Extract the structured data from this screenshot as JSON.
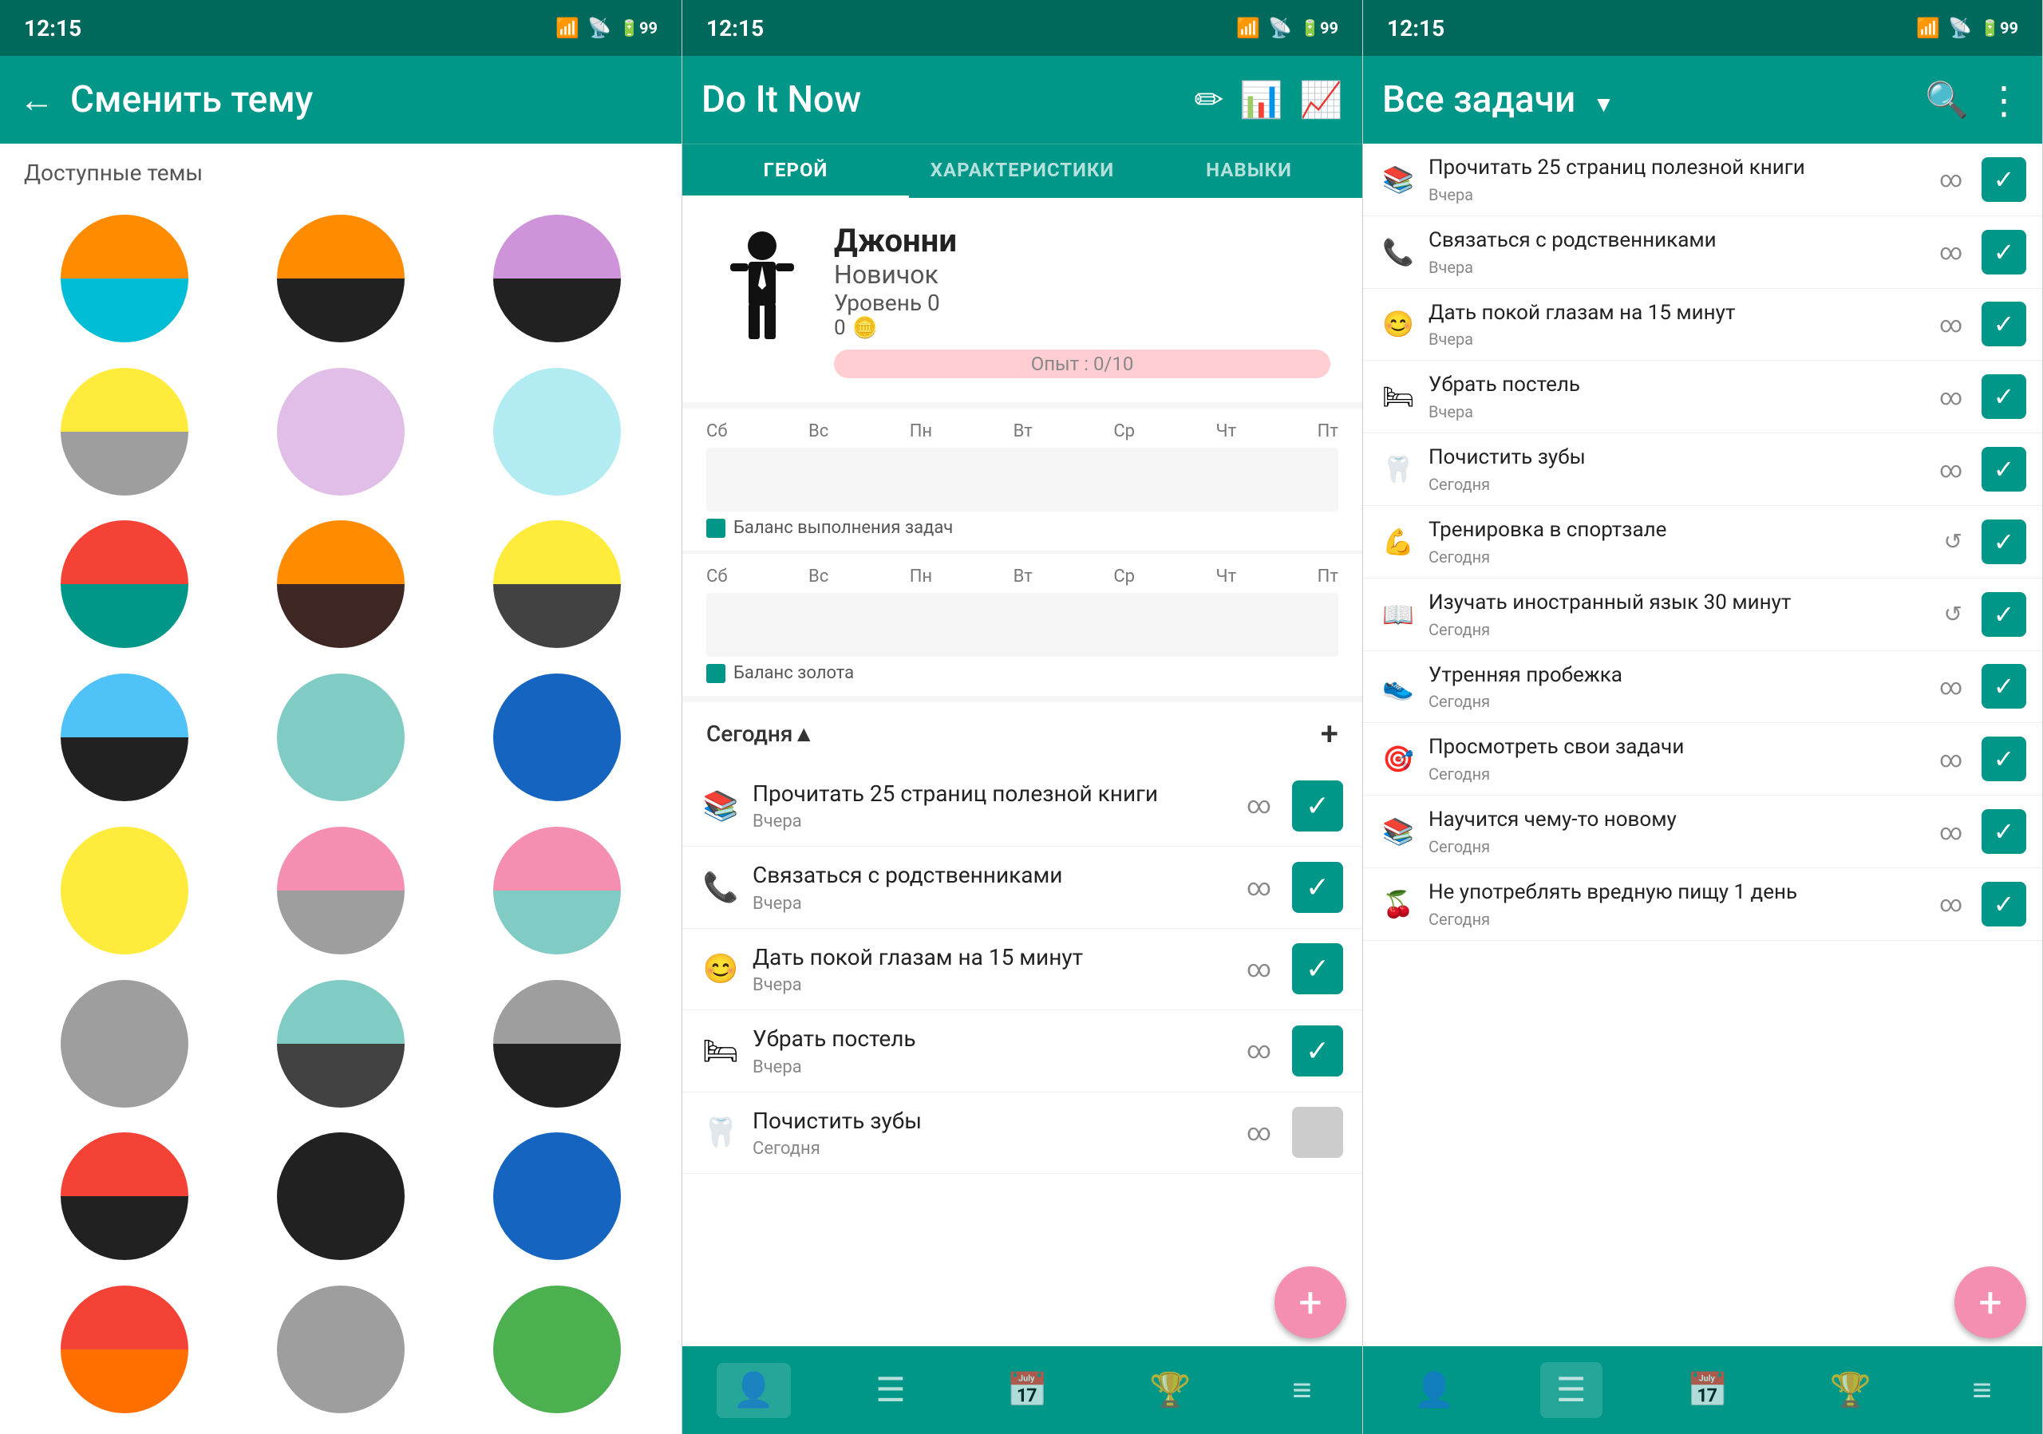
{
  "panel1": {
    "status_time": "12:15",
    "header": {
      "back_label": "←",
      "title": "Сменить тему"
    },
    "section_label": "Доступные темы",
    "themes": [
      {
        "top": "#FF8C00",
        "bottom": "#00BCD4"
      },
      {
        "top": "#FF8C00",
        "bottom": "#212121"
      },
      {
        "top": "#CE93D8",
        "bottom": "#212121"
      },
      {
        "top": "#FFEB3B",
        "bottom": "#9E9E9E"
      },
      {
        "top": "#E1BEE7",
        "bottom": "#E1BEE7"
      },
      {
        "top": "#B2EBF2",
        "bottom": "#B2EBF2"
      },
      {
        "top": "#F44336",
        "bottom": "#009688"
      },
      {
        "top": "#FF8C00",
        "bottom": "#3E2723"
      },
      {
        "top": "#FFEB3B",
        "bottom": "#424242"
      },
      {
        "top": "#4FC3F7",
        "bottom": "#212121"
      },
      {
        "top": "#80CBC4",
        "bottom": "#80CBC4"
      },
      {
        "top": "#1565C0",
        "bottom": "#1565C0"
      },
      {
        "top": "#FFEB3B",
        "bottom": "#FFEB3B"
      },
      {
        "top": "#F48FB1",
        "bottom": "#9E9E9E"
      },
      {
        "top": "#F48FB1",
        "bottom": "#80CBC4"
      },
      {
        "top": "#9E9E9E",
        "bottom": "#9E9E9E"
      },
      {
        "top": "#80CBC4",
        "bottom": "#424242"
      },
      {
        "top": "#9E9E9E",
        "bottom": "#212121"
      },
      {
        "top": "#F44336",
        "bottom": "#212121"
      },
      {
        "top": "#212121",
        "bottom": "#212121"
      },
      {
        "top": "#1565C0",
        "bottom": "#1565C0"
      },
      {
        "top": "#F44336",
        "bottom": "#FF6F00"
      },
      {
        "top": "#9E9E9E",
        "bottom": "#9E9E9E"
      },
      {
        "top": "#4CAF50",
        "bottom": "#4CAF50"
      }
    ]
  },
  "panel2": {
    "status_time": "12:15",
    "header": {
      "title": "Do It Now",
      "edit_icon": "✏",
      "bar_icon": "▐▌",
      "chart_icon": "📈"
    },
    "tabs": [
      {
        "label": "ГЕРОЙ",
        "active": true
      },
      {
        "label": "ХАРАКТЕРИСТИКИ",
        "active": false
      },
      {
        "label": "НАВЫКИ",
        "active": false
      }
    ],
    "hero": {
      "name": "Джонни",
      "rank": "Новичок",
      "level": "Уровень 0",
      "coins": "0",
      "exp_label": "Опыт : 0/10"
    },
    "chart1": {
      "days": [
        "Сб",
        "Вс",
        "Пн",
        "Вт",
        "Ср",
        "Чт",
        "Пт"
      ],
      "legend": "Баланс выполнения задач"
    },
    "chart2": {
      "days": [
        "Сб",
        "Вс",
        "Пн",
        "Вт",
        "Ср",
        "Чт",
        "Пт"
      ],
      "legend": "Баланс золота"
    },
    "tasks_header": "Сегодня",
    "tasks": [
      {
        "icon": "📚",
        "name": "Прочитать 25 страниц полезной книги",
        "date": "Вчера",
        "repeat": "∞",
        "done": true
      },
      {
        "icon": "📞",
        "name": "Связаться с родственниками",
        "date": "Вчера",
        "repeat": "∞",
        "done": true
      },
      {
        "icon": "😊",
        "name": "Дать покой глазам на 15 минут",
        "date": "Вчера",
        "repeat": "∞",
        "done": true
      },
      {
        "icon": "🛏",
        "name": "Убрать постель",
        "date": "Вчера",
        "repeat": "∞",
        "done": true
      },
      {
        "icon": "🦷",
        "name": "Почистить зубы",
        "date": "Сегодня",
        "repeat": "∞",
        "done": false
      }
    ],
    "fab_label": "+",
    "bottom_nav": [
      {
        "icon": "👤",
        "active": true
      },
      {
        "icon": "☰",
        "active": false
      },
      {
        "icon": "📅",
        "active": false
      },
      {
        "icon": "🏆",
        "active": false
      },
      {
        "icon": "≡",
        "active": false
      }
    ]
  },
  "panel3": {
    "status_time": "12:15",
    "header": {
      "title": "Все задачи",
      "dropdown_icon": "▼",
      "search_icon": "🔍",
      "more_icon": "⋮"
    },
    "tasks": [
      {
        "icon": "📚",
        "name": "Прочитать 25 страниц полезной книги",
        "date": "Вчера",
        "repeat": "∞",
        "done": true
      },
      {
        "icon": "📞",
        "name": "Связаться с родственниками",
        "date": "Вчера",
        "repeat": "∞",
        "done": true
      },
      {
        "icon": "😊",
        "name": "Дать покой глазам на 15 минут",
        "date": "Вчера",
        "repeat": "∞",
        "done": true
      },
      {
        "icon": "🛏",
        "name": "Убрать постель",
        "date": "Вчера",
        "repeat": "∞",
        "done": true
      },
      {
        "icon": "🦷",
        "name": "Почистить зубы",
        "date": "Сегодня",
        "repeat": "∞",
        "done": true
      },
      {
        "icon": "💪",
        "name": "Тренировка в спортзале",
        "date": "Сегодня",
        "repeat": "↺",
        "done": true
      },
      {
        "icon": "📖",
        "name": "Изучать иностранный язык 30 минут",
        "date": "Сегодня",
        "repeat": "↺",
        "done": true
      },
      {
        "icon": "👟",
        "name": "Утренняя пробежка",
        "date": "Сегодня",
        "repeat": "∞",
        "done": true
      },
      {
        "icon": "🎯",
        "name": "Просмотреть свои задачи",
        "date": "Сегодня",
        "repeat": "∞",
        "done": true
      },
      {
        "icon": "📚",
        "name": "Научится чему-то новому",
        "date": "Сегодня",
        "repeat": "∞",
        "done": true
      },
      {
        "icon": "🍒",
        "name": "Не употреблять вредную пищу 1 день",
        "date": "Сегодня",
        "repeat": "∞",
        "done": true
      }
    ],
    "fab_label": "+",
    "bottom_nav": [
      {
        "icon": "👤",
        "active": false
      },
      {
        "icon": "☰",
        "active": true
      },
      {
        "icon": "📅",
        "active": false
      },
      {
        "icon": "🏆",
        "active": false
      },
      {
        "icon": "≡",
        "active": false
      }
    ]
  }
}
